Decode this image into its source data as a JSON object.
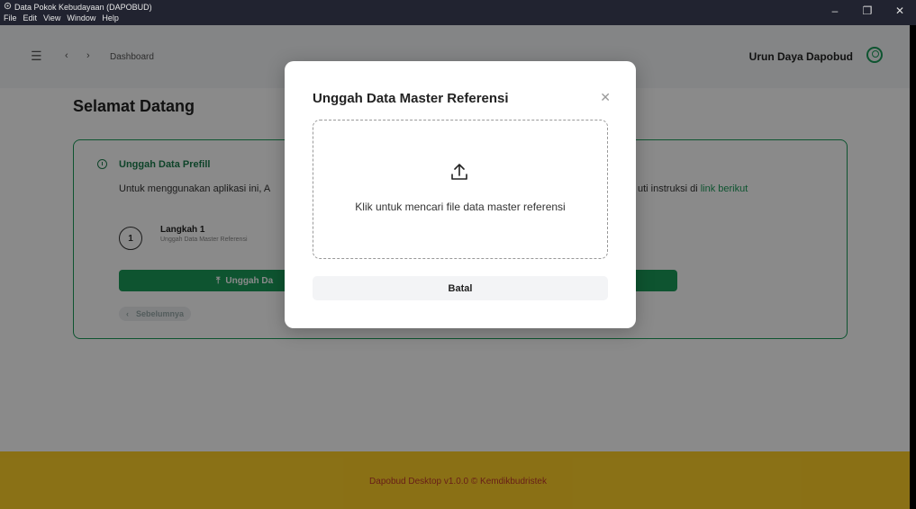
{
  "window": {
    "title": "Data Pokok Kebudayaan (DAPOBUD)",
    "menu": [
      "File",
      "Edit",
      "View",
      "Window",
      "Help"
    ],
    "controls": {
      "minimize": "–",
      "maximize": "❐",
      "close": "✕"
    }
  },
  "header": {
    "breadcrumb": "Dashboard",
    "user_label": "Urun Daya Dapobud",
    "accent_color": "#1a9b5a"
  },
  "main": {
    "welcome": "Selamat Datang",
    "card": {
      "title": "Unggah Data Prefill",
      "desc_left": "Untuk menggunakan aplikasi ini, A",
      "desc_right": "uti instruksi di",
      "link": "link berikut",
      "step_number": "1",
      "step_title": "Langkah 1",
      "step_subtitle": "Unggah Data Master Referensi",
      "upload_button": "Unggah Da",
      "prev_button": "Sebelumnya"
    }
  },
  "footer": {
    "text": "Dapobud Desktop v1.0.0 © Kemdikbudristek",
    "background_color": "#ffd028"
  },
  "modal": {
    "title": "Unggah Data Master Referensi",
    "dropzone_text": "Klik untuk mencari file data master referensi",
    "cancel_button": "Batal"
  }
}
